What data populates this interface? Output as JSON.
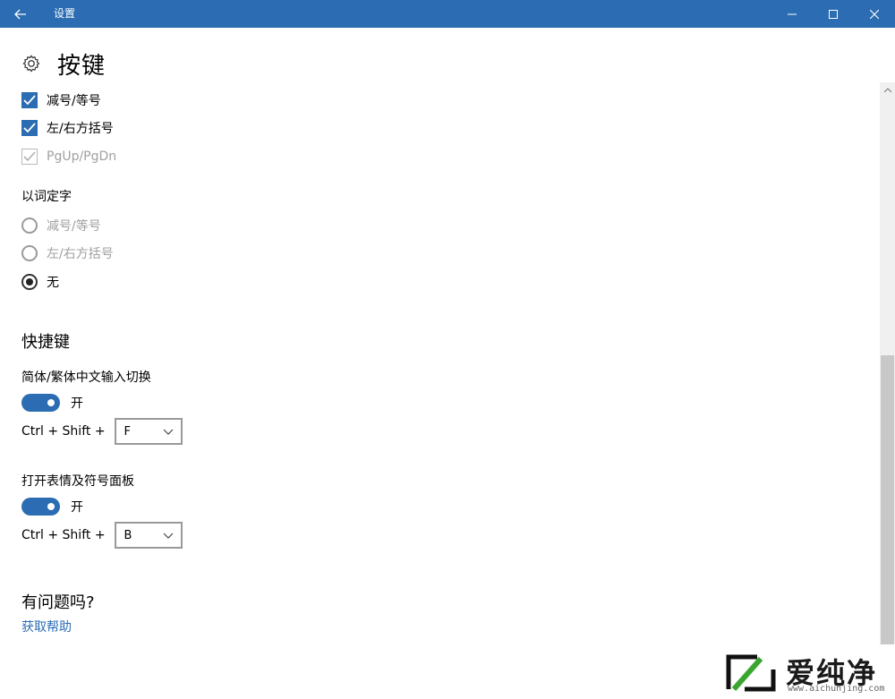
{
  "window": {
    "title": "设置"
  },
  "page": {
    "title": "按键"
  },
  "checkboxes": [
    {
      "label": "减号/等号",
      "checked": true,
      "enabled": true
    },
    {
      "label": "左/右方括号",
      "checked": true,
      "enabled": true
    },
    {
      "label": "PgUp/PgDn",
      "checked": true,
      "enabled": false
    }
  ],
  "word_select": {
    "label": "以词定字",
    "options": [
      {
        "label": "减号/等号",
        "selected": false,
        "enabled": false
      },
      {
        "label": "左/右方括号",
        "selected": false,
        "enabled": false
      },
      {
        "label": "无",
        "selected": true,
        "enabled": true
      }
    ]
  },
  "shortcuts": {
    "title": "快捷键",
    "items": [
      {
        "label": "简体/繁体中文输入切换",
        "toggle_state": "开",
        "on": true,
        "modifier": "Ctrl + Shift +",
        "key": "F"
      },
      {
        "label": "打开表情及符号面板",
        "toggle_state": "开",
        "on": true,
        "modifier": "Ctrl + Shift +",
        "key": "B"
      }
    ]
  },
  "help": {
    "title": "有问题吗?",
    "link": "获取帮助"
  },
  "watermark": {
    "text": "爱纯净",
    "sub": "www.aichunjing.com"
  },
  "colors": {
    "accent": "#2b6cb3",
    "titlebar": "#2b6cb3"
  }
}
